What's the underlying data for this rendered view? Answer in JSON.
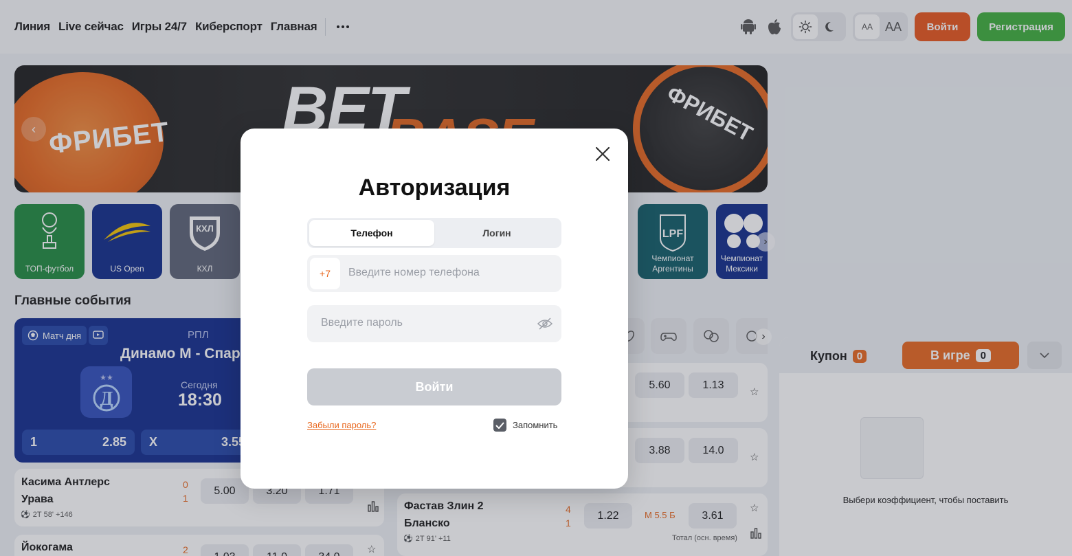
{
  "header": {
    "nav": [
      "Линия",
      "Live сейчас",
      "Игры 24/7",
      "Киберспорт",
      "Главная"
    ],
    "font_small": "AA",
    "font_large": "AA",
    "login": "Войти",
    "register": "Регистрация"
  },
  "banner": {
    "chip_left": "ФРИБЕТ",
    "chip_right": "ФРИБЕТ",
    "word1": "BET",
    "word2": "BASE"
  },
  "tiles": [
    {
      "label": "ТОП-футбол",
      "color": "#1e8a3e",
      "icon": "trophy-icon"
    },
    {
      "label": "US Open",
      "color": "#0f2a8a",
      "icon": "us-open-icon"
    },
    {
      "label": "КХЛ",
      "color": "#5a6275",
      "icon": "khl-icon"
    },
    {
      "label": "Чемпионат Аргентины",
      "color": "#0f5a66",
      "icon": "lpf-icon"
    },
    {
      "label": "Чемпионат Мексики",
      "color": "#0f2a8a",
      "icon": "liga-mx-icon"
    }
  ],
  "section_title": "Главные события",
  "match_of_day": {
    "badge": "Матч дня",
    "league": "РПЛ",
    "teams": "Динамо М - Спартак М",
    "date": "Сегодня",
    "time": "18:30",
    "odds": [
      {
        "label": "1",
        "value": "2.85"
      },
      {
        "label": "X",
        "value": "3.55"
      }
    ]
  },
  "events_left": [
    {
      "team1": "Касима Антлерс",
      "team2": "Урава",
      "score1": "0",
      "score2": "1",
      "meta": "2Т 58' +146",
      "odds": [
        "5.00",
        "3.20",
        "1.71"
      ]
    },
    {
      "team1": "Йокогама",
      "team2": "",
      "score1": "2",
      "score2": "",
      "meta": "",
      "odds": [
        "1.03",
        "11.0",
        "34.0"
      ]
    }
  ],
  "events_right": [
    {
      "odds": [
        "5.60",
        "1.13"
      ]
    },
    {
      "odds": [
        "3.88",
        "14.0"
      ]
    },
    {
      "team1": "Фастав Злин 2",
      "team2": "Бланско",
      "score1": "4",
      "score2": "1",
      "meta": "2Т 91' +11",
      "odd1": "1.22",
      "total": "М 5.5 Б",
      "odd2": "3.61",
      "total_label": "Тотал (осн. время)"
    }
  ],
  "coupon": {
    "tab1": "Купон",
    "tab1_count": "0",
    "tab2": "В игре",
    "tab2_count": "0",
    "hint": "Выбери коэффициент, чтобы поставить"
  },
  "modal": {
    "title": "Авторизация",
    "tab_phone": "Телефон",
    "tab_login": "Логин",
    "phone_code": "+7",
    "phone_placeholder": "Введите номер телефона",
    "password_placeholder": "Введите пароль",
    "submit": "Войти",
    "forgot": "Забыли пароль?",
    "remember": "Запомнить"
  },
  "colors": {
    "accent": "#e8661c",
    "green": "#3cae3a",
    "navy": "#102a8c"
  }
}
